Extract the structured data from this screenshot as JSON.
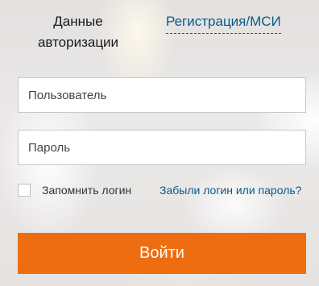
{
  "tabs": {
    "auth_line1": "Данные",
    "auth_line2": "авторизации",
    "registration": "Регистрация/МСИ"
  },
  "form": {
    "username_placeholder": "Пользователь",
    "username_value": "",
    "password_placeholder": "Пароль",
    "password_value": "",
    "remember_label": "Запомнить логин",
    "remember_checked": false,
    "forgot_link": "Забыли логин или пароль?",
    "submit_label": "Войти"
  },
  "colors": {
    "accent": "#ee6d11",
    "link": "#0a5a8a"
  }
}
